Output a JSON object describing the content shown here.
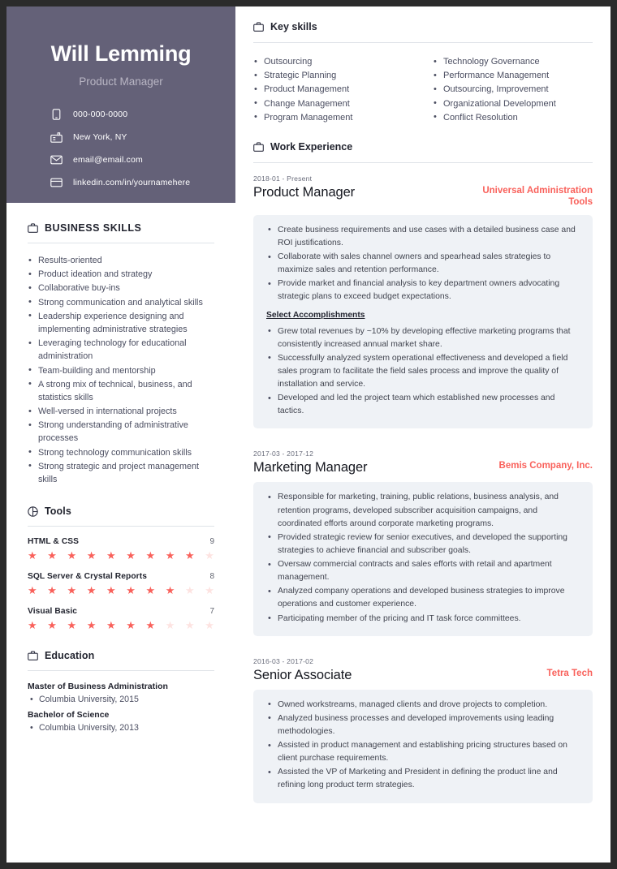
{
  "profile": {
    "name": "Will Lemming",
    "title": "Product Manager",
    "contacts": [
      {
        "icon": "phone-icon",
        "text": "000-000-0000"
      },
      {
        "icon": "building-icon",
        "text": "New York, NY"
      },
      {
        "icon": "envelope-icon",
        "text": "email@email.com"
      },
      {
        "icon": "card-icon",
        "text": "linkedin.com/in/yournamehere"
      }
    ]
  },
  "business_skills": {
    "icon": "briefcase-icon",
    "title": "BUSINESS SKILLS",
    "items": [
      "Results-oriented",
      "Product ideation and strategy",
      "Collaborative buy-ins",
      "Strong communication and analytical skills",
      "Leadership experience designing and implementing administrative strategies",
      "Leveraging technology for educational administration",
      "Team-building and mentorship",
      "A strong mix of technical, business, and statistics skills",
      "Well-versed in international projects",
      "Strong understanding of administrative processes",
      "Strong technology communication skills",
      "Strong strategic and project management skills"
    ]
  },
  "tools": {
    "icon": "pie-chart-icon",
    "title": "Tools",
    "max": 10,
    "items": [
      {
        "name": "HTML & CSS",
        "score": 9
      },
      {
        "name": "SQL Server & Crystal Reports",
        "score": 8
      },
      {
        "name": "Visual Basic",
        "score": 7
      }
    ]
  },
  "education": {
    "icon": "briefcase-icon",
    "title": "Education",
    "items": [
      {
        "degree": "Master of Business Administration",
        "school": "Columbia University, 2015"
      },
      {
        "degree": "Bachelor of Science",
        "school": "Columbia University, 2013"
      }
    ]
  },
  "key_skills": {
    "icon": "briefcase-icon",
    "title": "Key skills",
    "left": [
      "Outsourcing",
      "Strategic Planning",
      "Product Management",
      "Change Management",
      "Program Management"
    ],
    "right": [
      "Technology Governance",
      "Performance Management",
      "Outsourcing, Improvement",
      "Organizational Development",
      "Conflict Resolution"
    ]
  },
  "work_experience": {
    "icon": "briefcase-icon",
    "title": "Work Experience",
    "jobs": [
      {
        "date": "2018-01 - Present",
        "role": "Product Manager",
        "company": "Universal Administration Tools",
        "bullets": [
          "Create business requirements and use cases with a detailed business case and ROI justifications.",
          "Collaborate with sales channel owners and spearhead sales strategies to maximize sales and retention performance.",
          "Provide market and financial analysis to key department owners advocating strategic plans to exceed budget expectations."
        ],
        "accomplishments_label": "Select Accomplishments",
        "accomplishments": [
          "Grew total revenues by ~10% by developing effective marketing programs that consistently increased annual market share.",
          "Successfully analyzed system operational effectiveness and developed a field sales program to facilitate the field sales process and improve the quality of installation and service.",
          "Developed and led the project team which established new processes and tactics."
        ]
      },
      {
        "date": "2017-03 - 2017-12",
        "role": "Marketing Manager",
        "company": "Bemis Company, Inc.",
        "bullets": [
          "Responsible for marketing, training, public relations, business analysis, and retention programs, developed subscriber acquisition campaigns, and coordinated efforts around corporate marketing programs.",
          "Provided strategic review for senior executives, and developed the supporting strategies to achieve financial and subscriber goals.",
          "Oversaw commercial contracts and sales efforts with retail and apartment management.",
          "Analyzed company operations and developed business strategies to improve operations and customer experience.",
          "Participating member of the pricing and IT task force committees."
        ],
        "accomplishments_label": "",
        "accomplishments": []
      },
      {
        "date": "2016-03 - 2017-02",
        "role": "Senior Associate",
        "company": "Tetra Tech",
        "bullets": [
          "Owned workstreams, managed clients and drove projects to completion.",
          "Analyzed business processes and developed improvements using leading methodologies.",
          "Assisted in product management and establishing pricing structures based on client purchase requirements.",
          "Assisted the VP of Marketing and President in defining the product line and refining long product term strategies."
        ],
        "accomplishments_label": "",
        "accomplishments": []
      }
    ]
  },
  "colors": {
    "sidebar_bg": "#646178",
    "accent": "#f9615b",
    "accent_faded": "#fde3e1",
    "box_bg": "#eff2f6",
    "text_dark": "#22242f",
    "text_body": "#4a4d60"
  }
}
